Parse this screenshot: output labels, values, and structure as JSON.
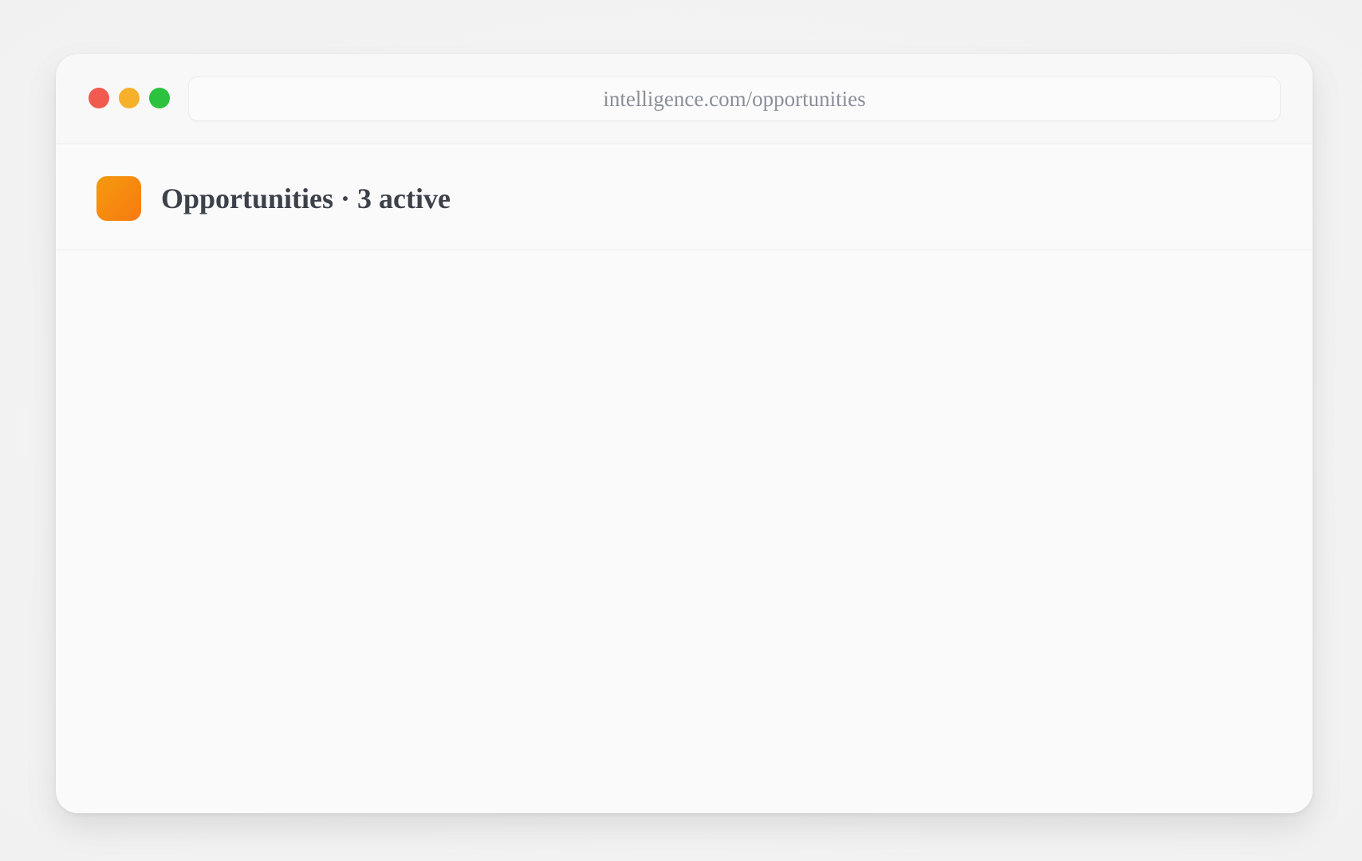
{
  "browser": {
    "url": "intelligence.com/opportunities",
    "controls": {
      "close_color": "#f05a4f",
      "minimize_color": "#f6b02a",
      "zoom_color": "#2cc23f"
    }
  },
  "header": {
    "icon": "app-logo-icon",
    "icon_color": "#f78a10",
    "title": "Opportunities · 3 active"
  }
}
